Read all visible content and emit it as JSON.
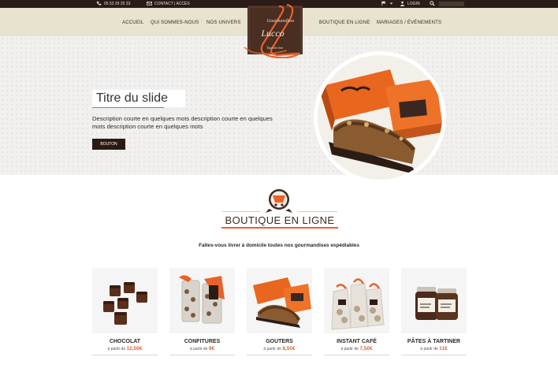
{
  "topbar": {
    "phone": "05 53 29 25 33",
    "contact": "CONTACT | ACCÈS",
    "login": "LOGIN"
  },
  "nav": {
    "left": [
      "ACCUEIL",
      "QUI SOMMES-NOUS",
      "NOS UNIVERS"
    ],
    "right": [
      "BOUTIQUE EN LIGNE",
      "MARIAGES / ÉVÉNEMENTS"
    ]
  },
  "logo": {
    "letter": "L",
    "line1": "Gourmandises",
    "line2": "Lucco",
    "line3": "Épicerie fine"
  },
  "hero": {
    "title": "Titre du slide",
    "description": "Description courte en quelques mots description courte en quelques mots description courte en quelques mots",
    "button": "BOUTON"
  },
  "boutique": {
    "title": "BOUTIQUE EN LIGNE",
    "subtitle": "Faîtes-vous livrer à domicile toutes nos gourmandises expédiables",
    "price_prefix": "à partir de",
    "products": [
      {
        "name": "CHOCOLAT",
        "price": "12,50€"
      },
      {
        "name": "CONFITURES",
        "price": "9€"
      },
      {
        "name": "GOUTERS",
        "price": "8,50€"
      },
      {
        "name": "INSTANT CAFÉ",
        "price": "7,50€"
      },
      {
        "name": "PÂTES À TARTINER",
        "price": "11€"
      }
    ]
  },
  "colors": {
    "accent": "#e8622a",
    "dark": "#2b1d16",
    "nav_bg": "#e7e3cf"
  }
}
